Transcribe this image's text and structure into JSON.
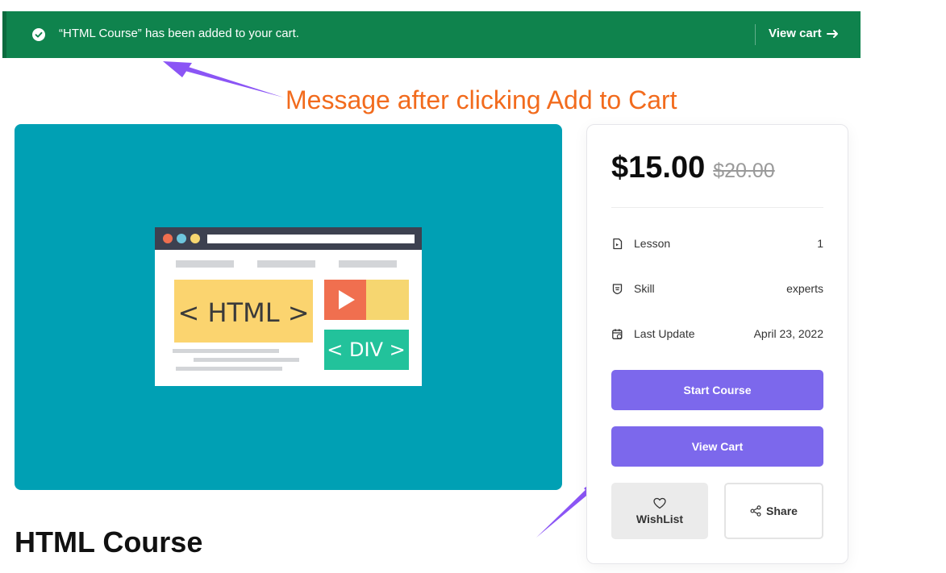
{
  "notice": {
    "message": "“HTML Course” has been added to your cart.",
    "link_label": "View cart",
    "background_color": "#0f834d",
    "icon": "check-circle-icon"
  },
  "annotation": {
    "text": "Message after clicking Add to Cart",
    "color": "#f26b1d"
  },
  "hero": {
    "image_text_html": "< HTML >",
    "image_text_div": "< DIV >",
    "background_color": "#00a0b4"
  },
  "course": {
    "title": "HTML Course"
  },
  "sidebar": {
    "price": "$15.00",
    "old_price": "$20.00",
    "meta": [
      {
        "icon": "lesson-icon",
        "label": "Lesson",
        "value": "1"
      },
      {
        "icon": "skill-icon",
        "label": "Skill",
        "value": "experts"
      },
      {
        "icon": "calendar-icon",
        "label": "Last Update",
        "value": "April 23, 2022"
      }
    ],
    "start_course_label": "Start Course",
    "view_cart_label": "View Cart",
    "wishlist_label": "WishList",
    "share_label": "Share",
    "accent_color": "#7c68ec"
  }
}
